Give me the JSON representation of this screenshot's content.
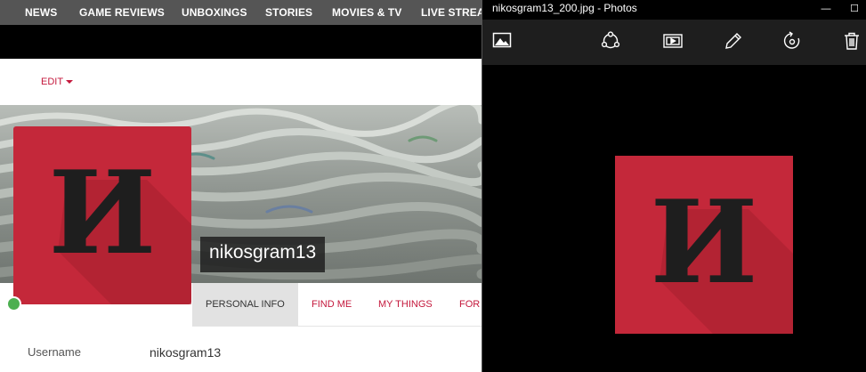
{
  "nav": {
    "items": [
      "News",
      "Game Reviews",
      "Unboxings",
      "Stories",
      "Movies & TV",
      "Live Stream"
    ]
  },
  "profile": {
    "edit_label": "EDIT",
    "username": "nikosgram13",
    "status": "online",
    "logo_letter": "И",
    "tabs": [
      "PERSONAL INFO",
      "FIND ME",
      "MY THINGS",
      "FOR"
    ],
    "info": {
      "label": "Username",
      "value": "nikosgram13"
    }
  },
  "photos_window": {
    "title": "nikosgram13_200.jpg - Photos",
    "controls": {
      "minimize": "—",
      "maximize": "☐",
      "close": "✕"
    },
    "toolbar_icons": [
      "collection-icon",
      "share-icon",
      "slideshow-icon",
      "edit-icon",
      "rotate-icon",
      "delete-icon"
    ]
  },
  "colors": {
    "brand_red": "#c4283a",
    "accent_link": "#c4183c",
    "online": "#4caf50"
  }
}
